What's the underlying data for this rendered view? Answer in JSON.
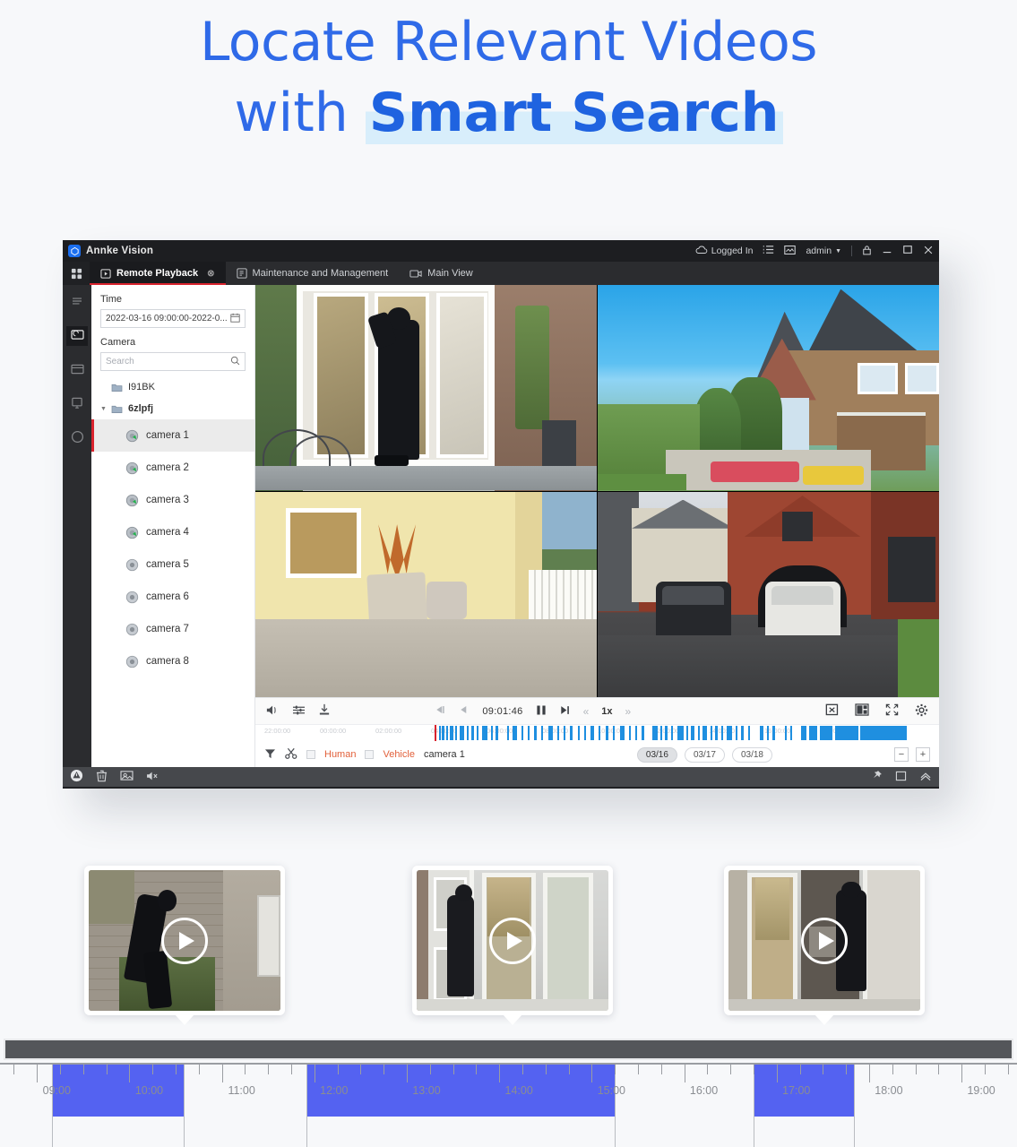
{
  "hero": {
    "line1": "Locate Relevant Videos",
    "line2_prefix": "with ",
    "line2_highlight": "Smart Search",
    "accent_color": "#2f6ae8",
    "highlight_bg": "#d8eefb"
  },
  "app": {
    "title": "Annke Vision",
    "titlebar": {
      "cloud_status": "Logged In",
      "user": "admin",
      "icons": [
        "cloud-icon",
        "list-icon",
        "picture-icon",
        "chevron-down-icon",
        "lock-icon",
        "minimize-icon",
        "maximize-icon",
        "close-icon"
      ]
    },
    "tabs": [
      {
        "label": "Remote Playback",
        "icon": "playback-icon",
        "active": true,
        "closable": true
      },
      {
        "label": "Maintenance and Management",
        "icon": "maintenance-icon",
        "active": false,
        "closable": false
      },
      {
        "label": "Main View",
        "icon": "camera-view-icon",
        "active": false,
        "closable": false
      }
    ],
    "rail_icons": [
      "grid-apps-icon",
      "menu-icon",
      "playback-icon",
      "window-icon",
      "monitor-icon",
      "circle-icon"
    ],
    "sidebar": {
      "time_label": "Time",
      "time_value": "2022-03-16 09:00:00-2022-0...",
      "calendar_icon": "calendar-icon",
      "camera_label": "Camera",
      "search_placeholder": "Search",
      "search_icon": "search-icon",
      "groups": [
        {
          "name": "I91BK",
          "expanded": false,
          "icon": "folder-icon"
        },
        {
          "name": "6zlpfj",
          "expanded": true,
          "icon": "folder-icon"
        }
      ],
      "cameras": [
        {
          "name": "camera 1",
          "online": true,
          "selected": true
        },
        {
          "name": "camera 2",
          "online": true,
          "selected": false
        },
        {
          "name": "camera 3",
          "online": true,
          "selected": false
        },
        {
          "name": "camera 4",
          "online": true,
          "selected": false
        },
        {
          "name": "camera 5",
          "online": false,
          "selected": false
        },
        {
          "name": "camera 6",
          "online": false,
          "selected": false
        },
        {
          "name": "camera 7",
          "online": false,
          "selected": false
        },
        {
          "name": "camera 8",
          "online": false,
          "selected": false
        }
      ]
    },
    "controls": {
      "volume_icon": "volume-mute-icon",
      "adjust_icon": "sliders-icon",
      "download_icon": "download-icon",
      "step_back_icon": "step-back-icon",
      "prev_frame_icon": "prev-frame-icon",
      "current_time": "09:01:46",
      "pause_icon": "pause-icon",
      "next_frame_icon": "next-frame-icon",
      "slow_icon": "rewind-icon",
      "speed": "1x",
      "fast_icon": "forward-icon",
      "stop_all_icon": "stop-all-icon",
      "layout_icon": "layout-icon",
      "fullscreen_icon": "fullscreen-icon",
      "settings_icon": "gear-icon"
    },
    "timeline": {
      "filter_icon": "filter-icon",
      "clip_icon": "scissors-icon",
      "filters": [
        {
          "label": "Human",
          "checked": false
        },
        {
          "label": "Vehicle",
          "checked": false
        }
      ],
      "channel": "camera 1",
      "ticks": [
        "22:00:00",
        "00:00:00",
        "02:00:00",
        "04:00:00",
        "06:00:00",
        "08:00:00",
        "10:00:00",
        "12:00:00",
        "14:00:00",
        "16:00:00",
        "18:00:00",
        "20:00:00"
      ],
      "dates": [
        {
          "label": "03/16",
          "selected": true
        },
        {
          "label": "03/17",
          "selected": false
        },
        {
          "label": "03/18",
          "selected": false
        }
      ],
      "zoom_out": "−",
      "zoom_in": "+",
      "record_color": "#1f8fe0"
    },
    "statusbar": {
      "icons": [
        "alarm-icon",
        "trash-icon",
        "snapshot-icon",
        "mute-icon"
      ],
      "right_icons": [
        "pin-icon",
        "window-icon",
        "chevron-up-icon"
      ]
    }
  },
  "thumbnails": [
    {
      "scene": "intruder-climbing-wall",
      "play_icon": "play-icon"
    },
    {
      "scene": "intruder-at-glass-door",
      "play_icon": "play-icon"
    },
    {
      "scene": "intruder-entering-door",
      "play_icon": "play-icon"
    }
  ],
  "chart_data": {
    "type": "bar",
    "title": "",
    "xlabel": "",
    "ylabel": "",
    "hour_labels": [
      "09:00",
      "10:00",
      "11:00",
      "12:00",
      "13:00",
      "14:00",
      "15:00",
      "16:00",
      "17:00",
      "18:00",
      "19:00"
    ],
    "xlim": [
      8.6,
      19.6
    ],
    "segment_color": "#4555f0",
    "segments": [
      {
        "start": "09:10",
        "end": "10:35"
      },
      {
        "start": "11:55",
        "end": "15:15"
      },
      {
        "start": "16:45",
        "end": "17:50"
      }
    ]
  }
}
